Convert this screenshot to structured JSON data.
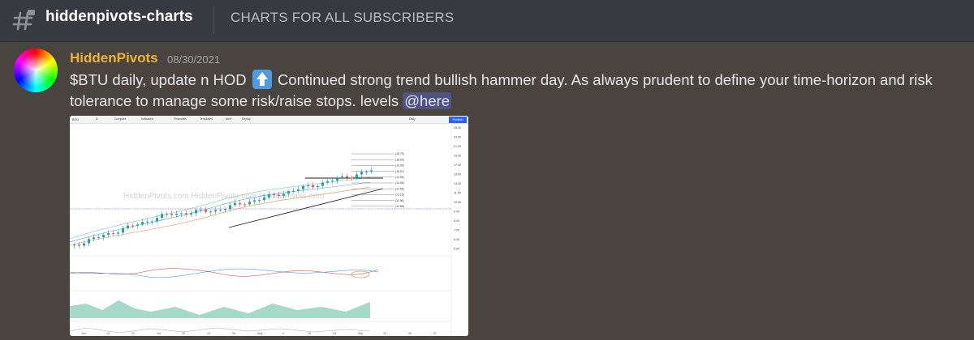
{
  "header": {
    "channel_name": "hiddenpivots-charts",
    "topic": "CHARTS FOR ALL SUBSCRIBERS"
  },
  "message": {
    "author": "HiddenPivots",
    "timestamp": "08/30/2021",
    "text_part1": "$BTU daily, update n HOD",
    "emoji": "up-arrow-emoji",
    "text_part2": "Continued strong trend bullish hammer day. As always prudent to define your time-horizon and risk tolerance to manage some risk/raise stops. levels",
    "mention": "@here"
  },
  "chart": {
    "ticker": "BTU",
    "interval": "D",
    "toolbar": {
      "compare": "Compare",
      "indicators": "Indicators",
      "financials": "Financials",
      "templates": "Templates",
      "alert": "Alert",
      "replay": "Replay",
      "range": "Daily",
      "publish": "Publish"
    },
    "watermark": "HiddenPivots.com HiddenPivots.com HiddenPivots.com",
    "x_labels": [
      "Jun",
      "14",
      "21",
      "Jul",
      "12",
      "19",
      "26",
      "Aug",
      "9",
      "16",
      "23",
      "Sep",
      "13",
      "20",
      "27"
    ],
    "price_labels": [
      "28.00",
      "24.00",
      "21.00",
      "19.00",
      "17.00",
      "15.00",
      "13.00",
      "11.50",
      "10.00",
      "9.00",
      "8.00",
      "7.00",
      "6.00",
      "5.00"
    ],
    "level_labels": [
      "18.75",
      "18.00",
      "16.96",
      "15.97",
      "14.96",
      "13.96",
      "12.96",
      "12.15",
      "11.96",
      "10.88"
    ]
  }
}
